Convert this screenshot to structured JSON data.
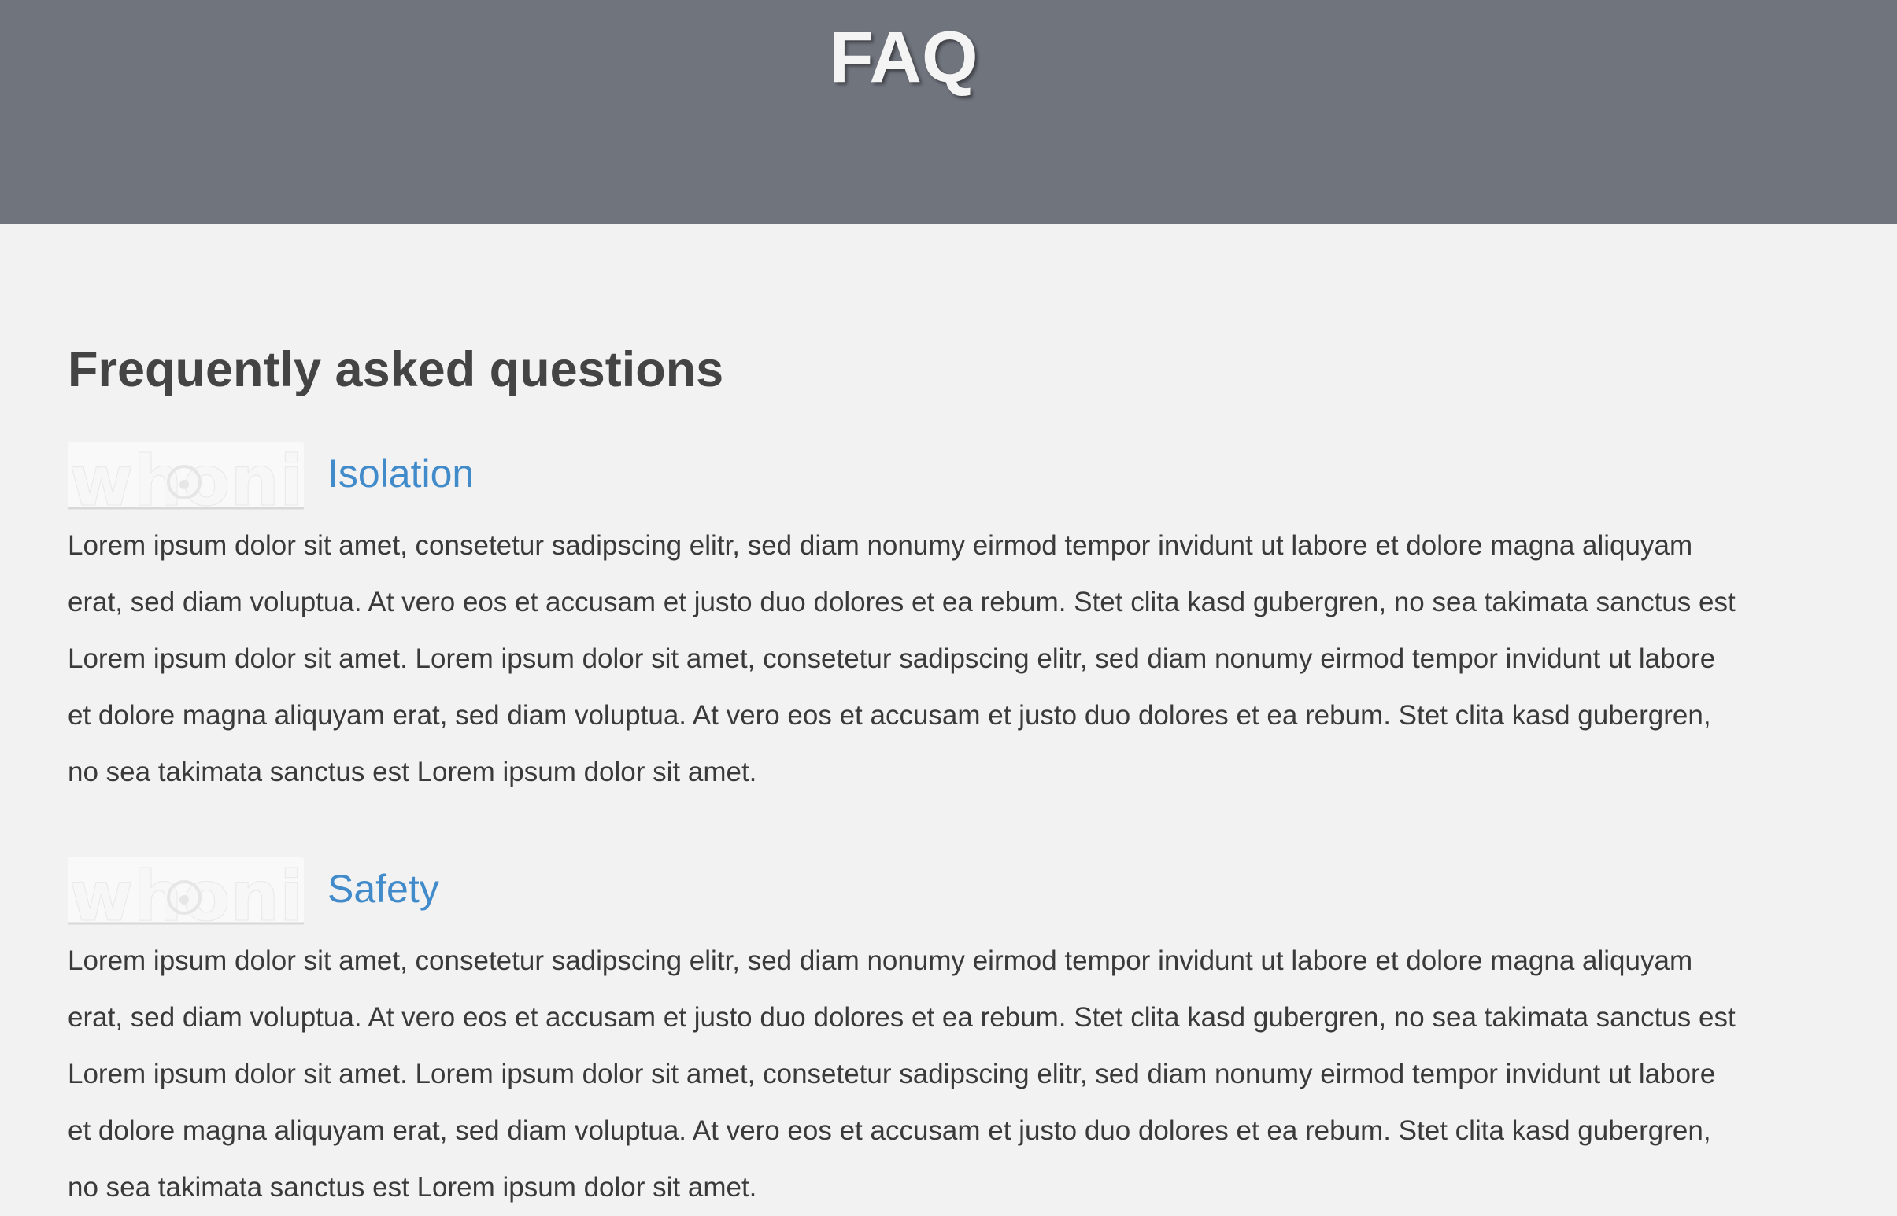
{
  "header": {
    "title": "FAQ"
  },
  "main": {
    "heading": "Frequently asked questions",
    "items": [
      {
        "logo_text": "whonix",
        "title": "Isolation",
        "body": "Lorem ipsum dolor sit amet, consetetur sadipscing elitr, sed diam nonumy eirmod tempor invidunt ut labore et dolore magna aliquyam erat, sed diam voluptua. At vero eos et accusam et justo duo dolores et ea rebum. Stet clita kasd gubergren, no sea takimata sanctus est Lorem ipsum dolor sit amet. Lorem ipsum dolor sit amet, consetetur sadipscing elitr, sed diam nonumy eirmod tempor invidunt ut labore et dolore magna aliquyam erat, sed diam voluptua. At vero eos et accusam et justo duo dolores et ea rebum. Stet clita kasd gubergren, no sea takimata sanctus est Lorem ipsum dolor sit amet."
      },
      {
        "logo_text": "whonix",
        "title": "Safety",
        "body": "Lorem ipsum dolor sit amet, consetetur sadipscing elitr, sed diam nonumy eirmod tempor invidunt ut labore et dolore magna aliquyam erat, sed diam voluptua. At vero eos et accusam et justo duo dolores et ea rebum. Stet clita kasd gubergren, no sea takimata sanctus est Lorem ipsum dolor sit amet. Lorem ipsum dolor sit amet, consetetur sadipscing elitr, sed diam nonumy eirmod tempor invidunt ut labore et dolore magna aliquyam erat, sed diam voluptua. At vero eos et accusam et justo duo dolores et ea rebum. Stet clita kasd gubergren, no sea takimata sanctus est Lorem ipsum dolor sit amet."
      }
    ]
  },
  "colors": {
    "header_bg": "#70747d",
    "page_bg": "#f2f2f2",
    "link_blue": "#428bca",
    "heading_text": "#444444",
    "body_text": "#3a3a3a"
  }
}
